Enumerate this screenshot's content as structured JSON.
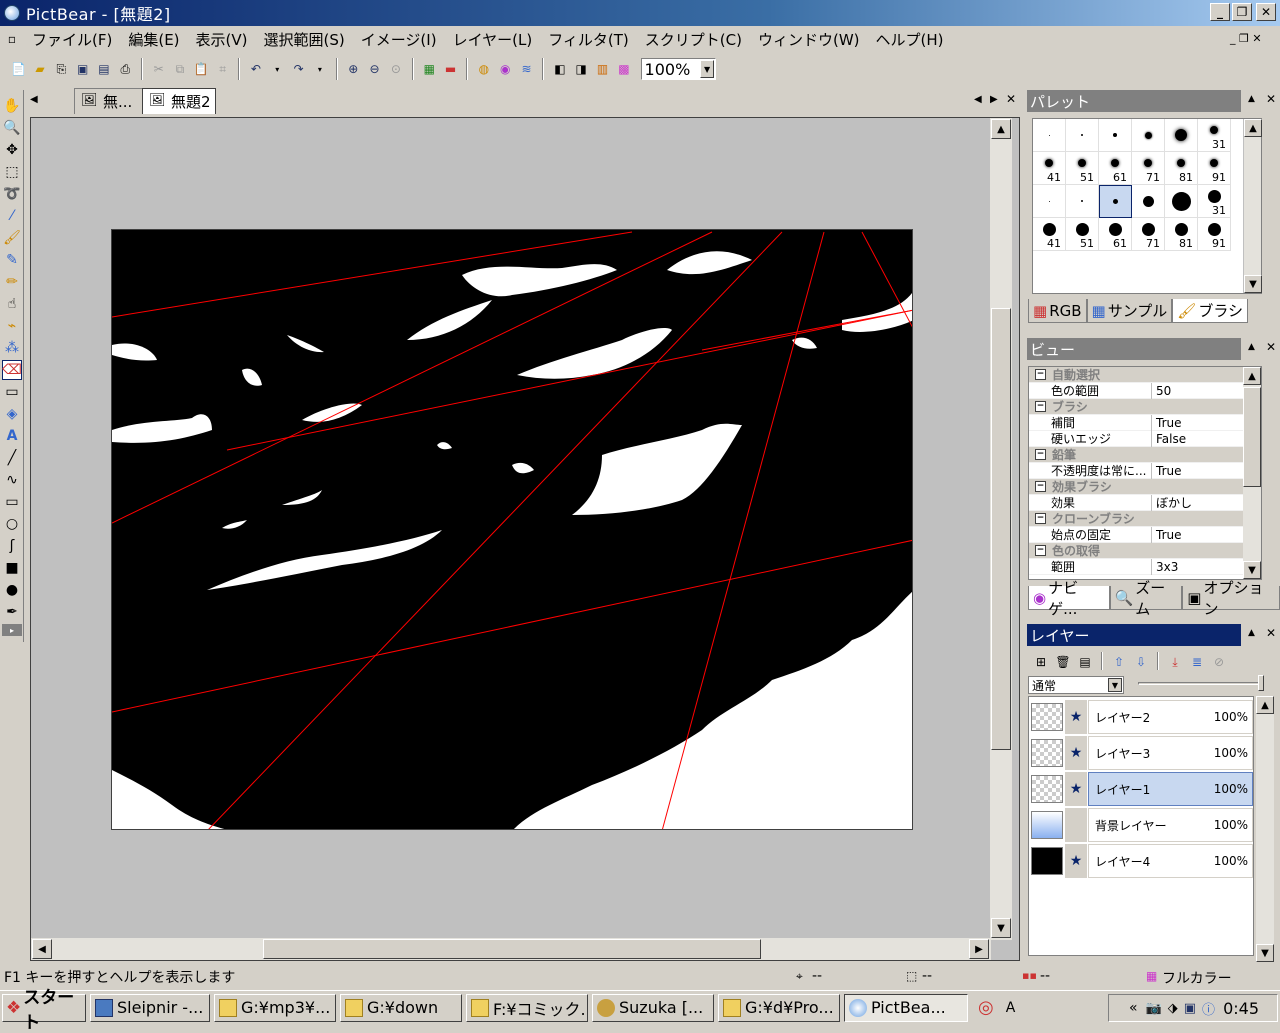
{
  "window": {
    "title": "PictBear - [無題2]"
  },
  "menu": [
    "ファイル(F)",
    "編集(E)",
    "表示(V)",
    "選択範囲(S)",
    "イメージ(I)",
    "レイヤー(L)",
    "フィルタ(T)",
    "スクリプト(C)",
    "ウィンドウ(W)",
    "ヘルプ(H)"
  ],
  "toolbar": {
    "zoom": "100%"
  },
  "doc_tabs": [
    "無...",
    "無題2"
  ],
  "palette": {
    "title": "パレット",
    "numbers": [
      "31",
      "41",
      "51",
      "61",
      "71",
      "81",
      "91",
      "31",
      "41",
      "51",
      "61",
      "71",
      "81",
      "91"
    ],
    "tabs": [
      "RGB",
      "サンプル",
      "ブラシ"
    ]
  },
  "view": {
    "title": "ビュー",
    "rows": [
      {
        "cat": "自動選択"
      },
      {
        "k": "色の範囲",
        "v": "50"
      },
      {
        "cat": "ブラシ"
      },
      {
        "k": "補間",
        "v": "True"
      },
      {
        "k": "硬いエッジ",
        "v": "False"
      },
      {
        "cat": "鉛筆"
      },
      {
        "k": "不透明度は常に...",
        "v": "True"
      },
      {
        "cat": "効果ブラシ"
      },
      {
        "k": "効果",
        "v": "ぼかし"
      },
      {
        "cat": "クローンブラシ"
      },
      {
        "k": "始点の固定",
        "v": "True"
      },
      {
        "cat": "色の取得"
      },
      {
        "k": "範囲",
        "v": "3x3"
      }
    ],
    "tabs": [
      "ナビゲ...",
      "ズーム",
      "オプション"
    ]
  },
  "layers": {
    "title": "レイヤー",
    "blend_mode": "通常",
    "items": [
      {
        "name": "レイヤー2",
        "opacity": "100%"
      },
      {
        "name": "レイヤー3",
        "opacity": "100%"
      },
      {
        "name": "レイヤー1",
        "opacity": "100%"
      },
      {
        "name": "背景レイヤー",
        "opacity": "100%"
      },
      {
        "name": "レイヤー4",
        "opacity": "100%"
      }
    ]
  },
  "status": {
    "help": "F1 キーを押すとヘルプを表示します",
    "pos1": "--",
    "pos2": "--",
    "pos3": "--",
    "color_mode": "フルカラー"
  },
  "taskbar": {
    "start": "スタート",
    "tasks": [
      "Sleipnir -...",
      "G:¥mp3¥...",
      "G:¥down",
      "F:¥コミック...",
      "Suzuka [...",
      "G:¥d¥Pro...",
      "PictBea..."
    ],
    "clock": "0:45"
  }
}
